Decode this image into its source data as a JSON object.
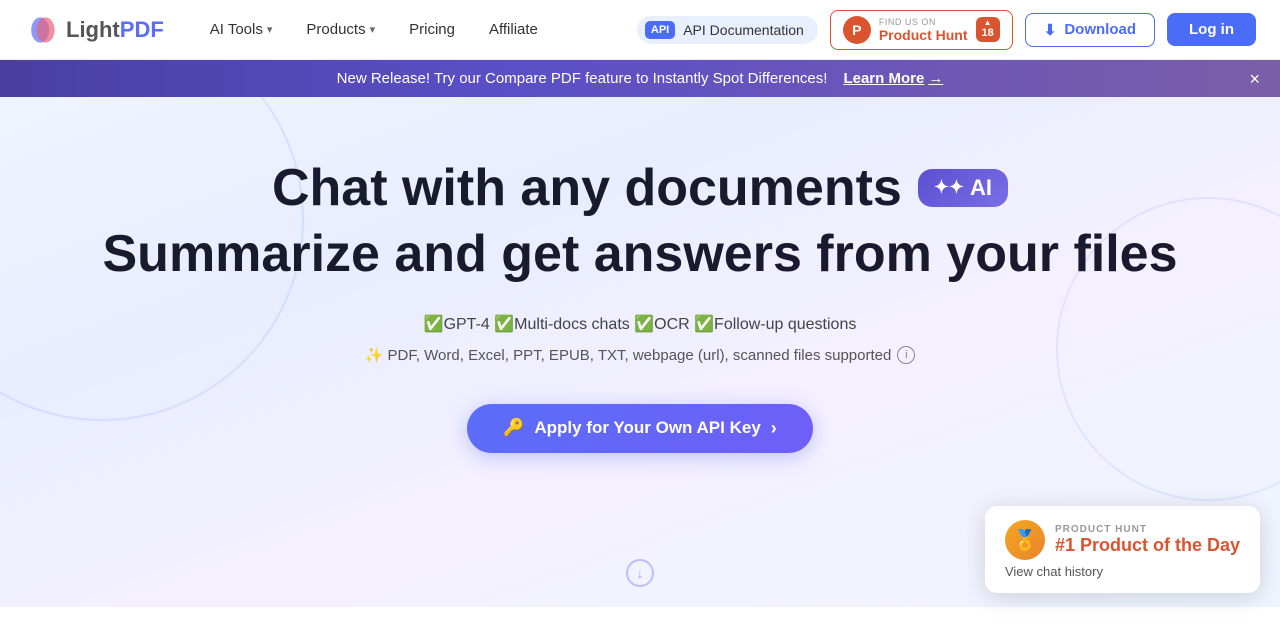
{
  "logo": {
    "light": "Light",
    "pdf": "PDF"
  },
  "nav": {
    "items": [
      {
        "label": "AI Tools",
        "hasDropdown": true
      },
      {
        "label": "Products",
        "hasDropdown": true
      },
      {
        "label": "Pricing",
        "hasDropdown": false
      },
      {
        "label": "Affiliate",
        "hasDropdown": false
      }
    ],
    "api_badge_label": "API",
    "api_doc_label": "API Documentation",
    "product_hunt_find": "FIND US ON",
    "product_hunt_name": "Product Hunt",
    "product_hunt_count": "18",
    "download_label": "Download",
    "login_label": "Log in"
  },
  "banner": {
    "text": "New Release! Try our Compare PDF feature to Instantly Spot Differences!",
    "link_label": "Learn More",
    "close_label": "×"
  },
  "hero": {
    "title_line1": "Chat with any documents",
    "ai_badge": "✦✦ AI",
    "title_line2": "Summarize and get answers from your files",
    "features": "✅GPT-4 ✅Multi-docs chats ✅OCR ✅Follow-up questions",
    "supported": "✨ PDF, Word, Excel, PPT, EPUB, TXT, webpage (url), scanned files supported",
    "cta_label": "Apply for Your Own API Key",
    "cta_icon": "🔑"
  },
  "product_hunt_badge": {
    "label": "PRODUCT HUNT",
    "title": "#1 Product of the Day",
    "sub_link": "View chat history"
  }
}
